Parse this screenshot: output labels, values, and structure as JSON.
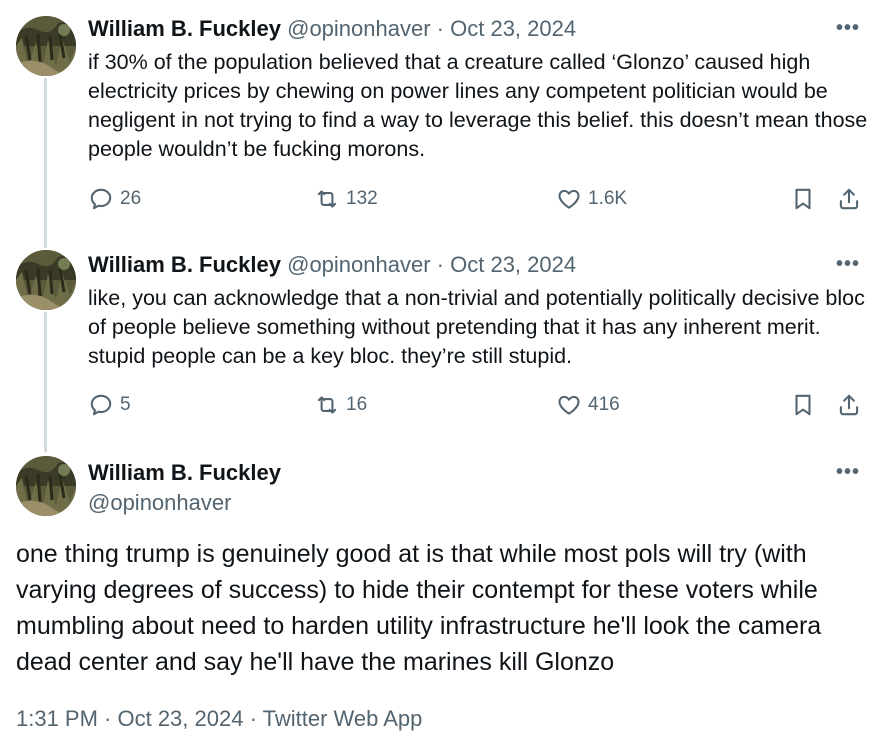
{
  "tweets": [
    {
      "name": "William B. Fuckley",
      "handle": "@opinonhaver",
      "sep": "·",
      "date": "Oct 23, 2024",
      "text": "if 30% of the population believed that a creature called ‘Glonzo’ caused high electricity prices by chewing on power lines any competent politician would be negligent in not trying to find a way to leverage this belief. this doesn’t mean those people wouldn’t be fucking morons.",
      "replies": "26",
      "retweets": "132",
      "likes": "1.6K"
    },
    {
      "name": "William B. Fuckley",
      "handle": "@opinonhaver",
      "sep": "·",
      "date": "Oct 23, 2024",
      "text": "like, you can acknowledge that a non-trivial and potentially politically decisive bloc of people believe something without pretending that it has any inherent merit. stupid people can be a key bloc. they’re still stupid.",
      "replies": "5",
      "retweets": "16",
      "likes": "416"
    }
  ],
  "main": {
    "name": "William B. Fuckley",
    "handle": "@opinonhaver",
    "text": "one thing trump is genuinely good at is that while most pols will try (with varying degrees of success) to hide their contempt for these voters while mumbling about  need to harden utility infrastructure he'll look the camera dead center and say he'll have the marines kill Glonzo",
    "footer": "1:31 PM · Oct 23, 2024 · Twitter Web App"
  },
  "icons": {
    "more": "more-icon",
    "reply": "reply-icon",
    "retweet": "retweet-icon",
    "like": "heart-icon",
    "bookmark": "bookmark-icon",
    "share": "share-icon"
  },
  "colors": {
    "text": "#0f1419",
    "muted": "#536471",
    "thread_line": "#cfd9de"
  }
}
